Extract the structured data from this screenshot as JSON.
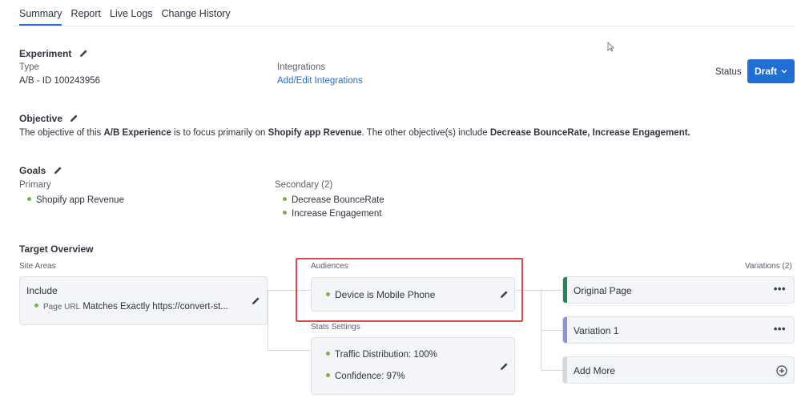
{
  "tabs": [
    "Summary",
    "Report",
    "Live Logs",
    "Change History"
  ],
  "experiment": {
    "heading": "Experiment",
    "type_label": "Type",
    "type_value": "A/B - ID 100243956",
    "integrations_label": "Integrations",
    "integrations_link": "Add/Edit Integrations",
    "status_label": "Status",
    "status_value": "Draft"
  },
  "objective": {
    "heading": "Objective",
    "text_1": "The objective of this ",
    "bold_1": "A/B Experience",
    "text_2": " is to focus primarily on ",
    "bold_2": "Shopify app Revenue",
    "text_3": ". The other objective(s) include ",
    "bold_3": "Decrease BounceRate, Increase Engagement."
  },
  "goals": {
    "heading": "Goals",
    "primary_label": "Primary",
    "primary_items": [
      "Shopify app Revenue"
    ],
    "secondary_label": "Secondary (2)",
    "secondary_items": [
      "Decrease BounceRate",
      "Increase Engagement"
    ]
  },
  "target": {
    "heading": "Target Overview",
    "site_areas_label": "Site Areas",
    "include_title": "Include",
    "rule_field": "Page URL",
    "rule_text": "Matches Exactly https://convert-st...",
    "audiences_label": "Audiences",
    "audience_item": "Device is Mobile Phone",
    "stats_label": "Stats Settings",
    "traffic": "Traffic Distribution: 100%",
    "confidence": "Confidence: 97%",
    "variations_label": "Variations (2)",
    "variations": [
      "Original Page",
      "Variation 1"
    ],
    "add_more": "Add More",
    "more_glyph": "•••"
  },
  "colors": {
    "accent": "#1f6fd6",
    "original_stripe": "#1e8a5a",
    "variation_stripe": "#8b93e0",
    "addmore_stripe": "#d5d9df",
    "goal_dot": "#7cb342",
    "highlight": "#d84c4c"
  }
}
